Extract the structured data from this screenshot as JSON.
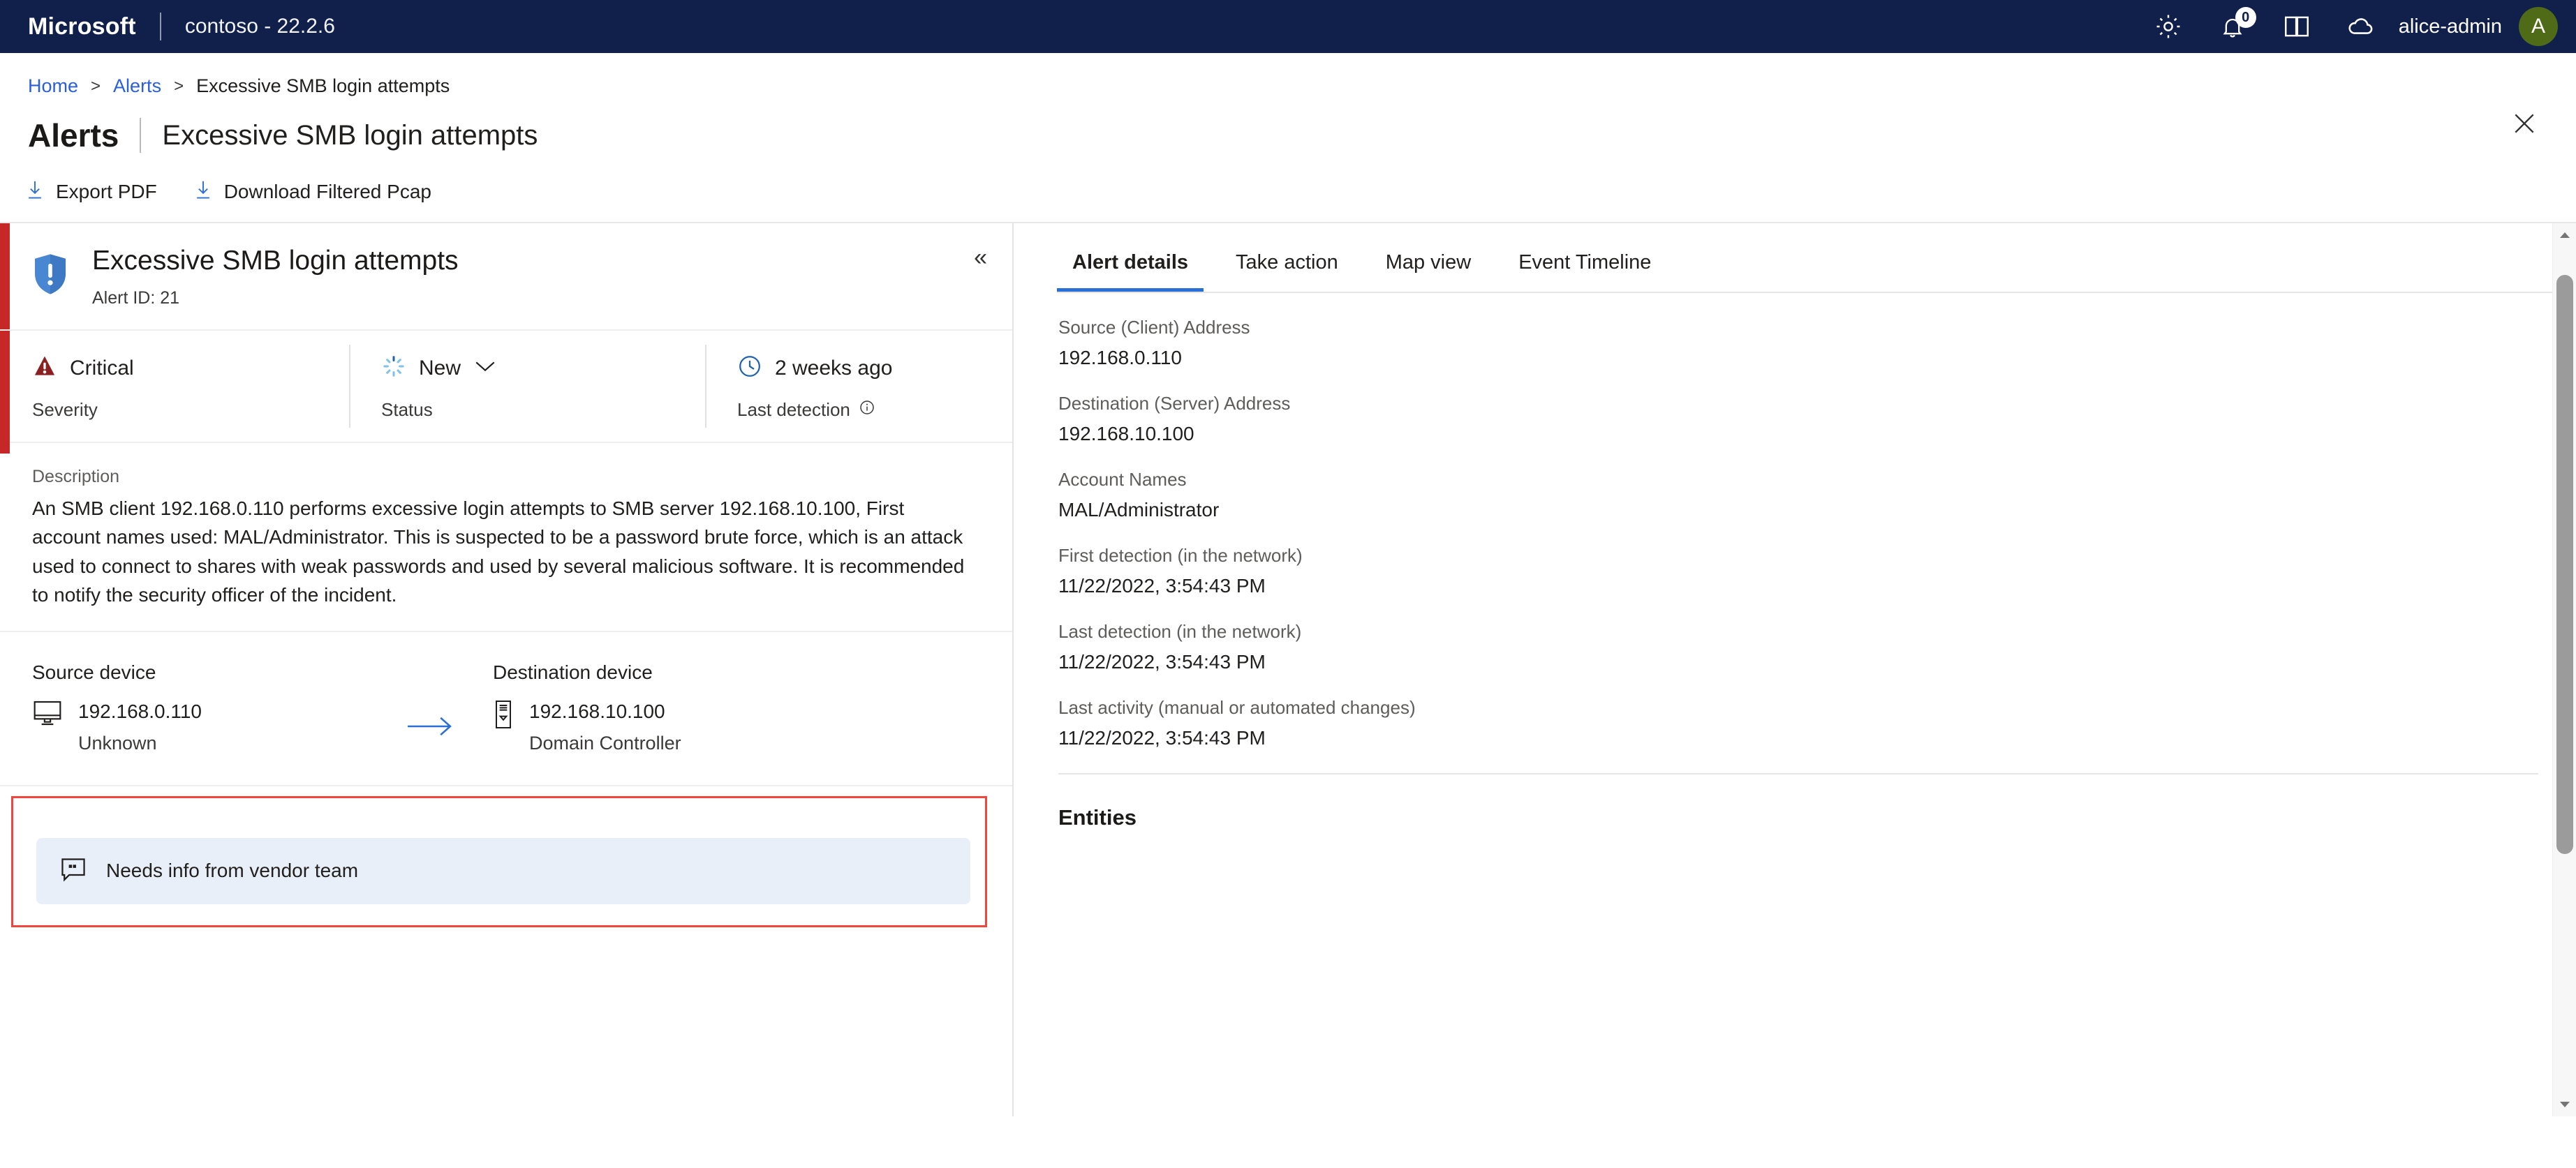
{
  "topbar": {
    "brand": "Microsoft",
    "tenant": "contoso - 22.2.6",
    "icons": [
      "gear-icon",
      "bell-icon",
      "book-icon",
      "cloud-icon"
    ],
    "notification_count": "0",
    "user_name": "alice-admin",
    "avatar_initial": "A",
    "avatar_color": "#4f6b17",
    "background_color": "#10204b"
  },
  "breadcrumb": {
    "home": "Home",
    "alerts": "Alerts",
    "current": "Excessive SMB login attempts",
    "separator": ">"
  },
  "page": {
    "title": "Alerts",
    "subtitle": "Excessive SMB login attempts"
  },
  "commandbar": {
    "export_pdf": "Export PDF",
    "download_pcap": "Download Filtered Pcap"
  },
  "alert": {
    "title": "Excessive SMB login attempts",
    "alert_id": "Alert ID: 21",
    "collapse_glyph": "«",
    "accent_color": "#c62828",
    "severity": {
      "value": "Critical",
      "label": "Severity",
      "color": "#8b2022"
    },
    "status": {
      "value": "New",
      "label": "Status"
    },
    "last_detection": {
      "value": "2 weeks ago",
      "label": "Last detection"
    },
    "description_label": "Description",
    "description": "An SMB client 192.168.0.110 performs excessive login attempts to SMB server 192.168.10.100, First account names used: MAL/Administrator. This is suspected to be a password brute force, which is an attack used to connect to shares with weak passwords and used by several malicious software. It is recommended to notify the security officer of the incident.",
    "source_device": {
      "heading": "Source device",
      "ip": "192.168.0.110",
      "type": "Unknown"
    },
    "destination_device": {
      "heading": "Destination device",
      "ip": "192.168.10.100",
      "type": "Domain Controller"
    },
    "comment": {
      "text": "Needs info from vendor team",
      "card_color": "#e9eff8",
      "highlight_color": "#f1453d"
    }
  },
  "right": {
    "tabs": [
      {
        "label": "Alert details",
        "active": true
      },
      {
        "label": "Take action",
        "active": false
      },
      {
        "label": "Map view",
        "active": false
      },
      {
        "label": "Event Timeline",
        "active": false
      }
    ],
    "fields": [
      {
        "label": "Source (Client) Address",
        "value": "192.168.0.110"
      },
      {
        "label": "Destination (Server) Address",
        "value": "192.168.10.100"
      },
      {
        "label": "Account Names",
        "value": "MAL/Administrator"
      },
      {
        "label": "First detection (in the network)",
        "value": "11/22/2022, 3:54:43 PM"
      },
      {
        "label": "Last detection (in the network)",
        "value": "11/22/2022, 3:54:43 PM"
      },
      {
        "label": "Last activity (manual or automated changes)",
        "value": "11/22/2022, 3:54:43 PM"
      }
    ],
    "entities_title": "Entities"
  }
}
